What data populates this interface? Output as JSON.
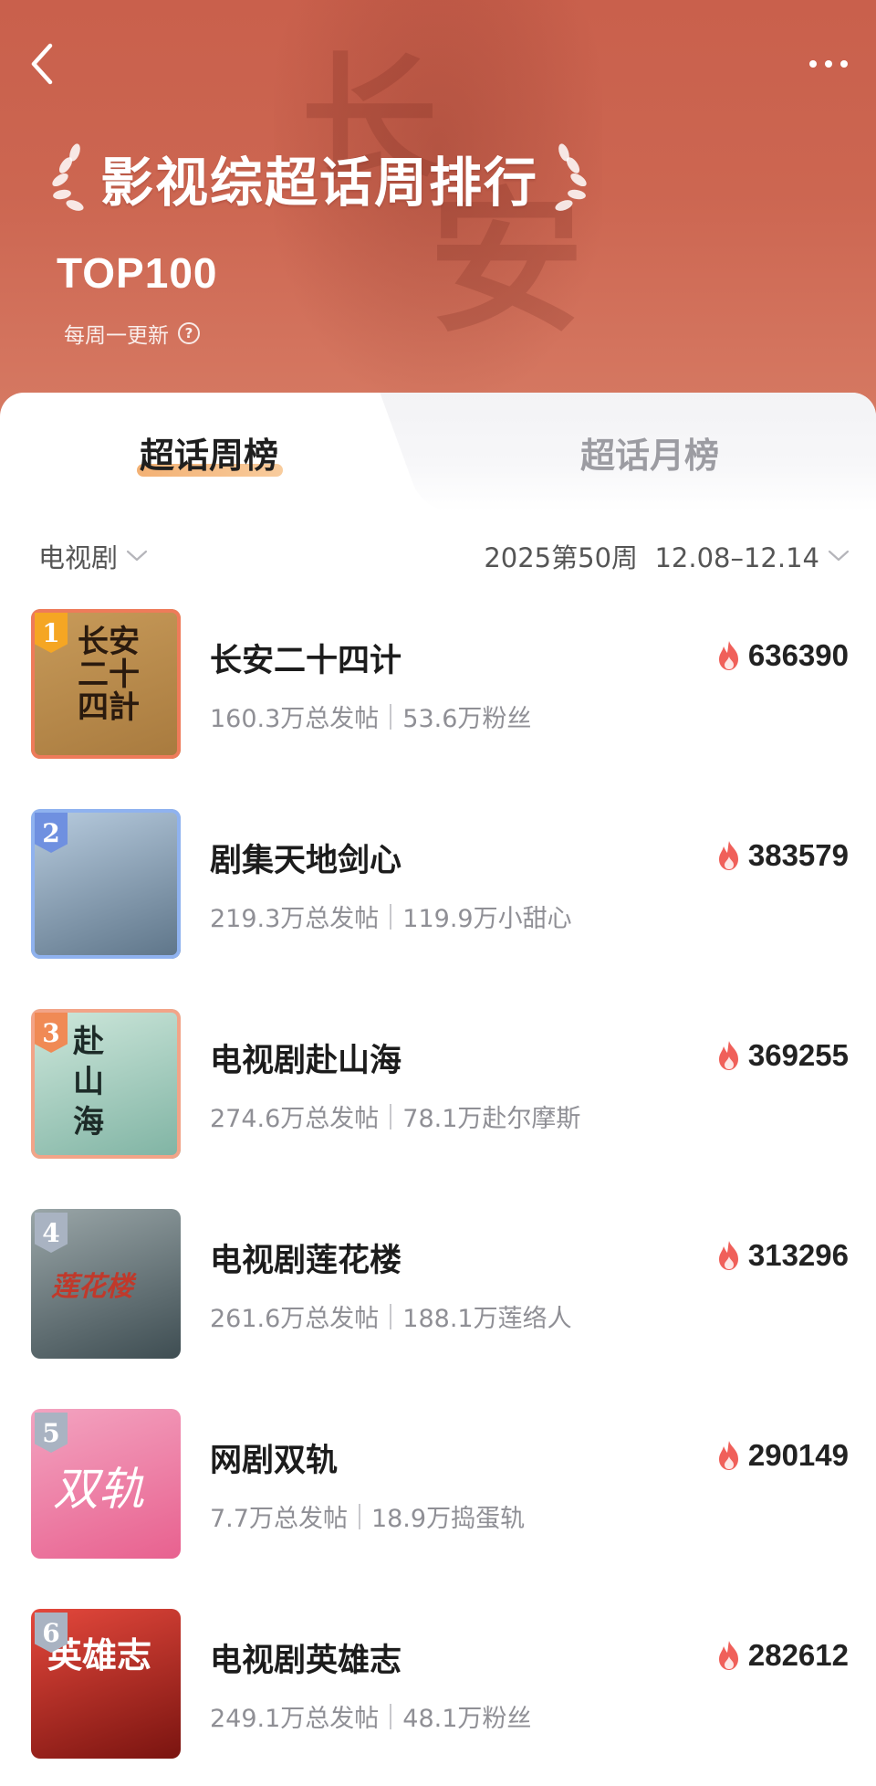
{
  "header": {
    "title": "影视综超话周排行",
    "subtitle": "TOP100",
    "update_note": "每周一更新",
    "help_glyph": "?"
  },
  "tabs": [
    {
      "label": "超话周榜",
      "active": true
    },
    {
      "label": "超话月榜",
      "active": false
    }
  ],
  "filters": {
    "category": "电视剧",
    "period": "2025第50周  12.08–12.14"
  },
  "colors": {
    "banner": "#cc6651",
    "accent_underline": "#f1a35b",
    "fire": "#f0605a"
  },
  "items": [
    {
      "rank": "1",
      "name": "长安二十四计",
      "posts": "160.3万总发帖",
      "fans": "53.6万粉丝",
      "heat": "636390",
      "badge_color": "#f5a623",
      "frame_color": "#ee7b5a",
      "poster_colors": [
        "#c89b5a",
        "#a87a3e"
      ],
      "poster_text": "长安二十四計",
      "poster_text_color": "#2a1a0e"
    },
    {
      "rank": "2",
      "name": "剧集天地剑心",
      "posts": "219.3万总发帖",
      "fans": "119.9万小甜心",
      "heat": "383579",
      "badge_color": "#6f90e0",
      "frame_color": "#8fb2ef",
      "poster_colors": [
        "#b9cde0",
        "#5d7488"
      ],
      "poster_text": "",
      "poster_text_color": "#ffffff"
    },
    {
      "rank": "3",
      "name": "电视剧赴山海",
      "posts": "274.6万总发帖",
      "fans": "78.1万赴尔摩斯",
      "heat": "369255",
      "badge_color": "#f08a55",
      "frame_color": "#f2a488",
      "poster_colors": [
        "#cfe8dc",
        "#7fb3a3"
      ],
      "poster_text": "赴山海",
      "poster_text_color": "#1d2b28"
    },
    {
      "rank": "4",
      "name": "电视剧莲花楼",
      "posts": "261.6万总发帖",
      "fans": "188.1万莲络人",
      "heat": "313296",
      "badge_color": "#a9b3c2",
      "frame_color": "#ffffff",
      "poster_colors": [
        "#9aa6a8",
        "#3e4d52"
      ],
      "poster_text": "莲花楼",
      "poster_text_color": "#c0392b"
    },
    {
      "rank": "5",
      "name": "网剧双轨",
      "posts": "7.7万总发帖",
      "fans": "18.9万捣蛋轨",
      "heat": "290149",
      "badge_color": "#a9b3c2",
      "frame_color": "#ffffff",
      "poster_colors": [
        "#f3a3c0",
        "#e8618f"
      ],
      "poster_text": "双轨",
      "poster_text_color": "#ffffff"
    },
    {
      "rank": "6",
      "name": "电视剧英雄志",
      "posts": "249.1万总发帖",
      "fans": "48.1万粉丝",
      "heat": "282612",
      "badge_color": "#a9b3c2",
      "frame_color": "#ffffff",
      "poster_colors": [
        "#e4483c",
        "#7a1410"
      ],
      "poster_text": "英雄志",
      "poster_text_color": "#ffffff"
    }
  ]
}
